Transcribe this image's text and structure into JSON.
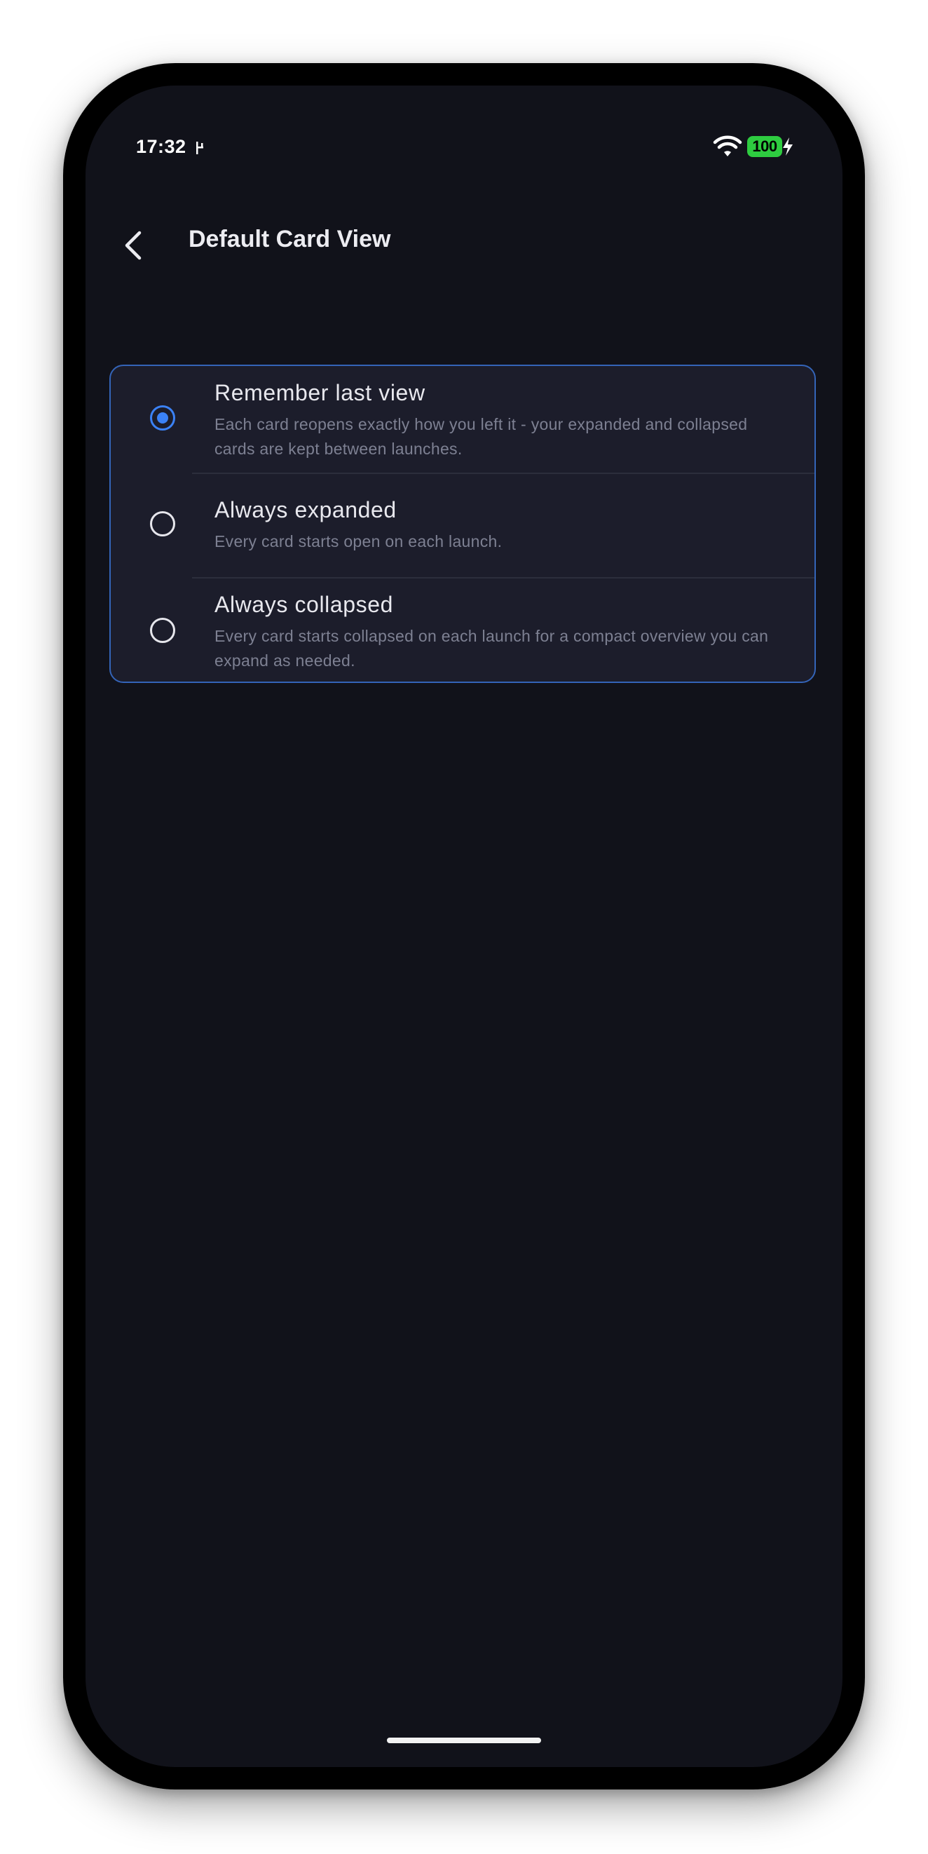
{
  "status_bar": {
    "time": "17:32",
    "battery": "100"
  },
  "header": {
    "title": "Default Card View"
  },
  "options": [
    {
      "title": "Remember last view",
      "description": "Each card reopens exactly how you left it - your expanded and collapsed cards are kept between launches.",
      "selected": true
    },
    {
      "title": "Always expanded",
      "description": "Every card starts open on each launch.",
      "selected": false
    },
    {
      "title": "Always collapsed",
      "description": "Every card starts collapsed on each launch for a compact overview you can expand as needed.",
      "selected": false
    }
  ],
  "colors": {
    "background": "#11121a",
    "card": "#1c1d2b",
    "accent": "#3b82f6",
    "battery": "#2ecc40"
  }
}
